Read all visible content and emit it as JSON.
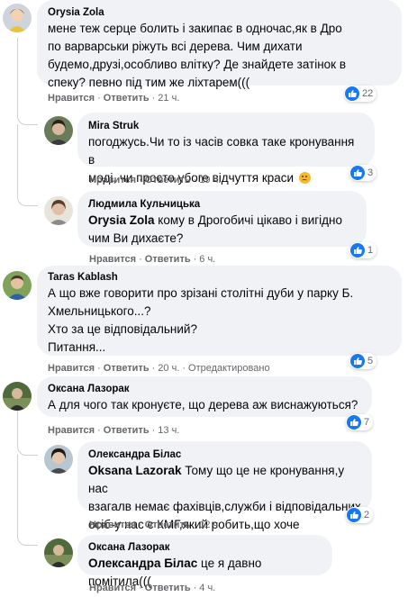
{
  "actions": {
    "like": "Нравится",
    "reply": "Ответить",
    "dot": "·"
  },
  "colors": {
    "bubble": "#f0f2f5",
    "like_blue": "#1877f2",
    "meta_gray": "#65676b"
  },
  "comments": [
    {
      "author": "Orysia Zola",
      "text": "мене теж серце болить і закипає в одночас,як в Дро\nпо варварськи ріжуть всі дерева. Чим дихати\nбудемо,друзі,особливо влітку? Де знайдете затінок в\nспеку? певно під тим же ліхтарем(((",
      "time": "21 ч.",
      "reactions": "22"
    },
    {
      "author": "Mira Struk",
      "text": "погоджусь.Чи то із часів совка таке кронування в\nмоді, чи просто убоге відчуття краси",
      "emoji": "sad-face-emoji",
      "time": "19 ч.",
      "reactions": "3"
    },
    {
      "author": "Людмила Кульчицька",
      "mention": "Orysia Zola",
      "text": " кому в Дрогобичі цікаво і вигідно\nчим Ви дихаєте?",
      "time": "6 ч.",
      "reactions": "1"
    },
    {
      "author": "Taras Kablash",
      "text": "А що вже говорити про зрізані столітні дуби у парку Б.\nХмельницького...?\nХто за це відповідальний?\nПитання...",
      "time": "20 ч.",
      "edited": "Отредактировано",
      "reactions": "5"
    },
    {
      "author": "Оксана Лазорак",
      "text": "А для чого так кронуєте, що дерева аж виснажуються?",
      "time": "13 ч.",
      "reactions": "7"
    },
    {
      "author": "Олександра Білас",
      "mention": "Oksana Lazorak",
      "text": " Тому що це не кронування,у нас\nвзагалв немає фахівців,служби і відповідальних\nосіб-у нас є КМГ,який робить,що хоче",
      "time": "12 ч.",
      "reactions": "2"
    },
    {
      "author": "Оксана Лазорак",
      "mention": "Олександра Білас",
      "text": " це я давно помітила(((",
      "time": "4 ч."
    }
  ]
}
